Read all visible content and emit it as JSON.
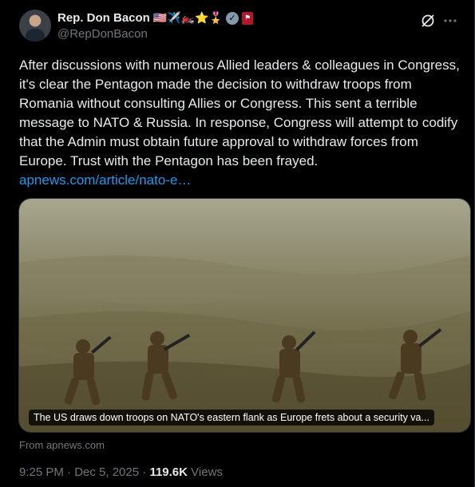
{
  "author": {
    "display_name": "Rep. Don Bacon",
    "name_emojis": "🇺🇸✈️🏍️⭐🎖️",
    "handle": "@RepDonBacon",
    "verified_icon": "gray-verified-check-icon",
    "affiliation_icon": "us-congress-badge-icon"
  },
  "header_actions": {
    "grok_icon": "grok-icon",
    "more_icon": "ellipsis-icon"
  },
  "tweet": {
    "text": "After discussions with numerous Allied leaders & colleagues in Congress, it's clear the Pentagon made the decision to withdraw troops from Romania without consulting Allies or Congress. This sent a terrible message to NATO & Russia. In response, Congress will attempt to codify that the Admin must obtain future approval to withdraw forces from Europe. Trust with the Pentagon has been frayed.",
    "link_text": "apnews.com/article/nato-e…"
  },
  "link_card": {
    "caption": "The US draws down troops on NATO's eastern flank as Europe frets about a security va...",
    "source": "From apnews.com"
  },
  "meta": {
    "timestamp": "9:25 PM · Dec 5, 2025",
    "separator": " · ",
    "views_count": "119.6K",
    "views_label": "Views"
  },
  "colors": {
    "background": "#000000",
    "text_primary": "#e7e9ea",
    "text_secondary": "#71767b",
    "link": "#1d9bf0",
    "border": "#2f3336"
  }
}
